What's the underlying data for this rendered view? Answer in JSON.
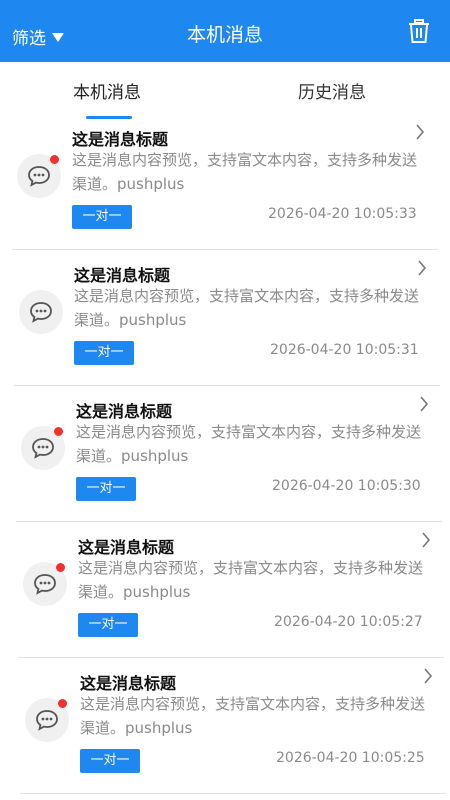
{
  "header": {
    "filter_label": "筛选",
    "title": "本机消息",
    "trash_icon": "trash-icon"
  },
  "tabs": [
    {
      "label": "本机消息",
      "active": true
    },
    {
      "label": "历史消息",
      "active": false
    }
  ],
  "messages": [
    {
      "title": "这是消息标题",
      "body": "这是消息内容预览，支持富文本内容，支持多种发送渠道。pushplus",
      "badge": "一对一",
      "time": "2026-04-20 10:05:33",
      "unread": true
    },
    {
      "title": "这是消息标题",
      "body": "这是消息内容预览，支持富文本内容，支持多种发送渠道。pushplus",
      "badge": "一对一",
      "time": "2026-04-20 10:05:31",
      "unread": false
    },
    {
      "title": "这是消息标题",
      "body": "这是消息内容预览，支持富文本内容，支持多种发送渠道。pushplus",
      "badge": "一对一",
      "time": "2026-04-20 10:05:30",
      "unread": true
    },
    {
      "title": "这是消息标题",
      "body": "这是消息内容预览，支持富文本内容，支持多种发送渠道。pushplus",
      "badge": "一对一",
      "time": "2026-04-20 10:05:27",
      "unread": true
    },
    {
      "title": "这是消息标题",
      "body": "这是消息内容预览，支持富文本内容，支持多种发送渠道。pushplus",
      "badge": "一对一",
      "time": "2026-04-20 10:05:25",
      "unread": true
    }
  ],
  "colors": {
    "accent": "#1e88f0",
    "unread_dot": "#f23030"
  }
}
